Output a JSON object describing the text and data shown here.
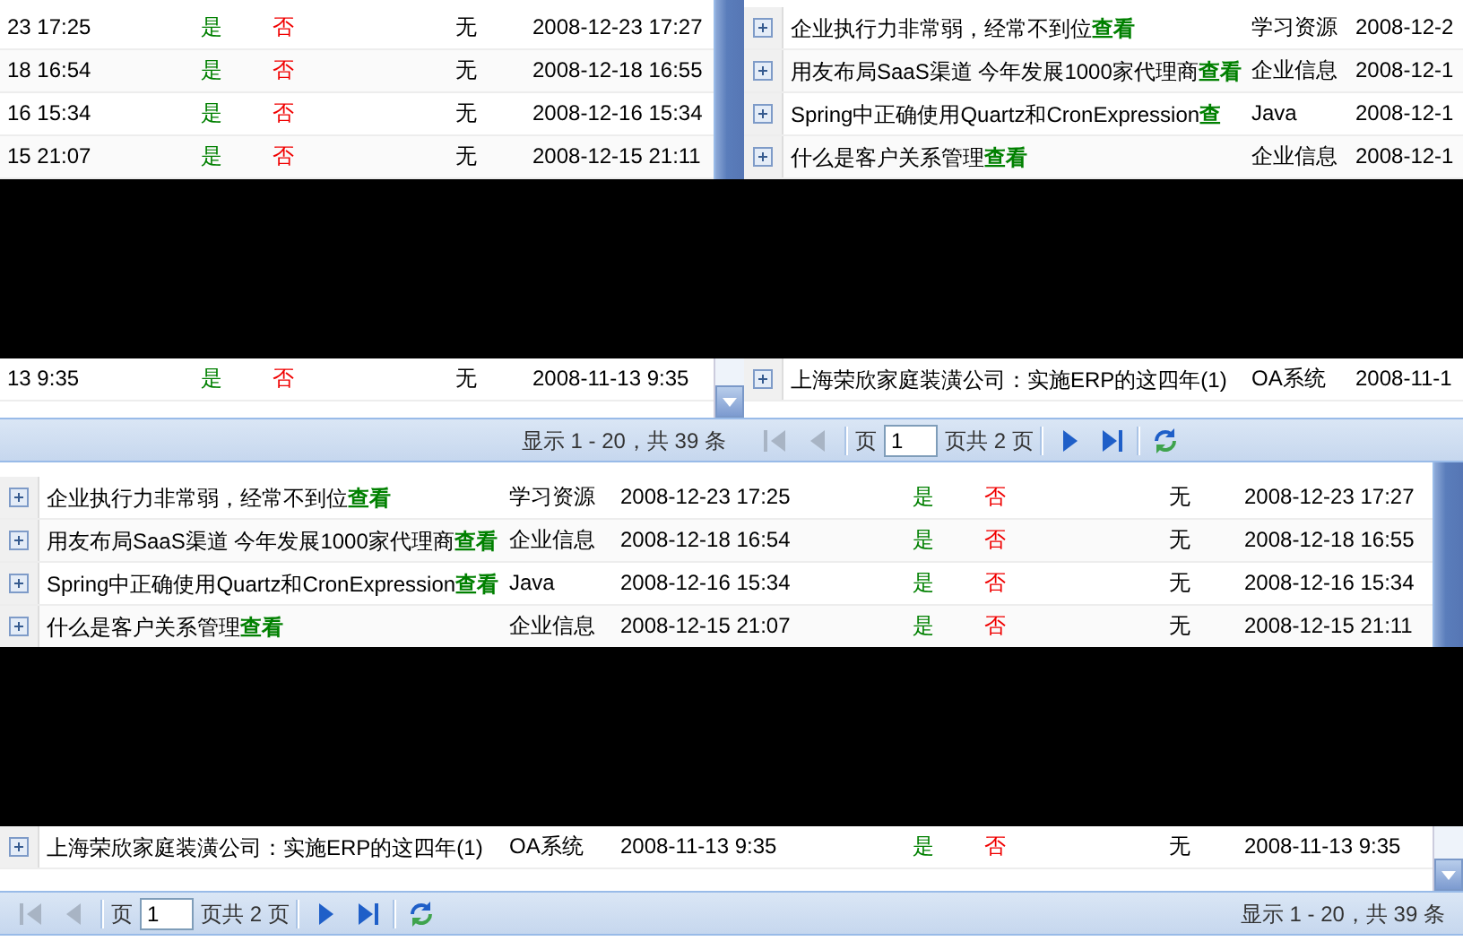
{
  "top_left_grid": {
    "rows": [
      {
        "date": "23 17:25",
        "flag_a": "是",
        "flag_b": "否",
        "flag_c": "无",
        "date_2": "2008-12-23 17:27"
      },
      {
        "date": "18 16:54",
        "flag_a": "是",
        "flag_b": "否",
        "flag_c": "无",
        "date_2": "2008-12-18 16:55"
      },
      {
        "date": "16 15:34",
        "flag_a": "是",
        "flag_b": "否",
        "flag_c": "无",
        "date_2": "2008-12-16 15:34"
      },
      {
        "date": "15 21:07",
        "flag_a": "是",
        "flag_b": "否",
        "flag_c": "无",
        "date_2": "2008-12-15 21:11"
      }
    ],
    "lower_rows": [
      {
        "date": "13 9:35",
        "flag_a": "是",
        "flag_b": "否",
        "flag_c": "无",
        "date_2": "2008-11-13 9:35"
      }
    ]
  },
  "top_right_grid": {
    "rows": [
      {
        "expanded": false,
        "title": "企业执行力非常弱，经常不到位",
        "link": "查看",
        "category": "学习资源",
        "date": "2008-12-2"
      },
      {
        "expanded": false,
        "title": "用友布局SaaS渠道 今年发展1000家代理商",
        "link": "查看",
        "category": "企业信息",
        "date": "2008-12-1"
      },
      {
        "expanded": false,
        "title": "Spring中正确使用Quartz和CronExpression",
        "link": "查",
        "category": "Java",
        "date": "2008-12-1"
      },
      {
        "expanded": false,
        "title": "什么是客户关系管理",
        "link": "查看",
        "category": "企业信息",
        "date": "2008-12-1"
      }
    ],
    "lower_rows": [
      {
        "expanded": false,
        "title": "上海荣欣家庭装潢公司：实施ERP的这四年(1)",
        "category": "OA系统",
        "date": "2008-11-1"
      }
    ]
  },
  "top_toolbar": {
    "summary": "显示 1 - 20，共 39 条",
    "pager": {
      "buttons": [
        {
          "kind": "first",
          "disabled": true
        },
        {
          "kind": "prev",
          "disabled": true
        }
      ],
      "page_label": "页",
      "page_value": "1",
      "page_total": "页共 2 页",
      "nav_buttons": [
        {
          "kind": "next",
          "disabled": false
        },
        {
          "kind": "last",
          "disabled": false
        },
        {
          "kind": "refresh",
          "disabled": false
        }
      ]
    }
  },
  "bottom_grid": {
    "rows": [
      {
        "expanded": false,
        "title": "企业执行力非常弱，经常不到位",
        "link": "查看",
        "category": "学习资源",
        "date": "2008-12-23 17:25",
        "flag_a": "是",
        "flag_b": "否",
        "flag_c": "无",
        "date_2": "2008-12-23 17:27"
      },
      {
        "expanded": false,
        "title": "用友布局SaaS渠道 今年发展1000家代理商",
        "link": "查看",
        "category": "企业信息",
        "date": "2008-12-18 16:54",
        "flag_a": "是",
        "flag_b": "否",
        "flag_c": "无",
        "date_2": "2008-12-18 16:55"
      },
      {
        "expanded": false,
        "title": "Spring中正确使用Quartz和CronExpression",
        "link": "查看",
        "category": "Java",
        "date": "2008-12-16 15:34",
        "flag_a": "是",
        "flag_b": "否",
        "flag_c": "无",
        "date_2": "2008-12-16 15:34"
      },
      {
        "expanded": false,
        "title": "什么是客户关系管理",
        "link": "查看",
        "category": "企业信息",
        "date": "2008-12-15 21:07",
        "flag_a": "是",
        "flag_b": "否",
        "flag_c": "无",
        "date_2": "2008-12-15 21:11"
      }
    ],
    "lower_rows": [
      {
        "expanded": false,
        "title": "上海荣欣家庭装潢公司：实施ERP的这四年(1)",
        "category": "OA系统",
        "date": "2008-11-13 9:35",
        "flag_a": "是",
        "flag_b": "否",
        "flag_c": "无",
        "date_2": "2008-11-13 9:35"
      }
    ]
  },
  "bottom_toolbar": {
    "pager": {
      "buttons": [
        {
          "kind": "first",
          "disabled": true
        },
        {
          "kind": "prev",
          "disabled": true
        }
      ],
      "page_label": "页",
      "page_value": "1",
      "page_total": "页共 2 页",
      "nav_buttons": [
        {
          "kind": "next",
          "disabled": false
        },
        {
          "kind": "last",
          "disabled": false
        },
        {
          "kind": "refresh",
          "disabled": false
        }
      ]
    },
    "summary": "显示 1 - 20，共 39 条"
  }
}
